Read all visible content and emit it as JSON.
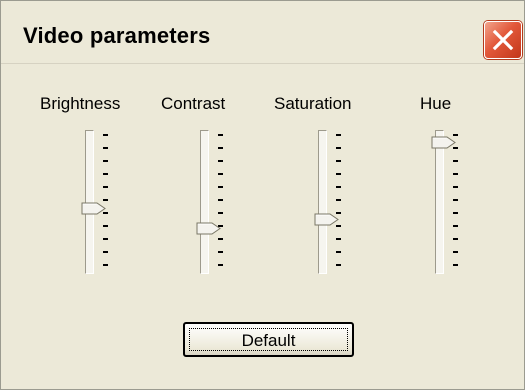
{
  "window": {
    "title": "Video parameters",
    "close_icon": "close-x-icon"
  },
  "sliders": [
    {
      "label": "Brightness",
      "value_fraction": 0.55
    },
    {
      "label": "Contrast",
      "value_fraction": 0.7
    },
    {
      "label": "Saturation",
      "value_fraction": 0.63
    },
    {
      "label": "Hue",
      "value_fraction": 0.03
    }
  ],
  "buttons": {
    "default_label": "Default"
  },
  "colors": {
    "dialog_background": "#ece9d8",
    "close_button": "#e2583a"
  }
}
